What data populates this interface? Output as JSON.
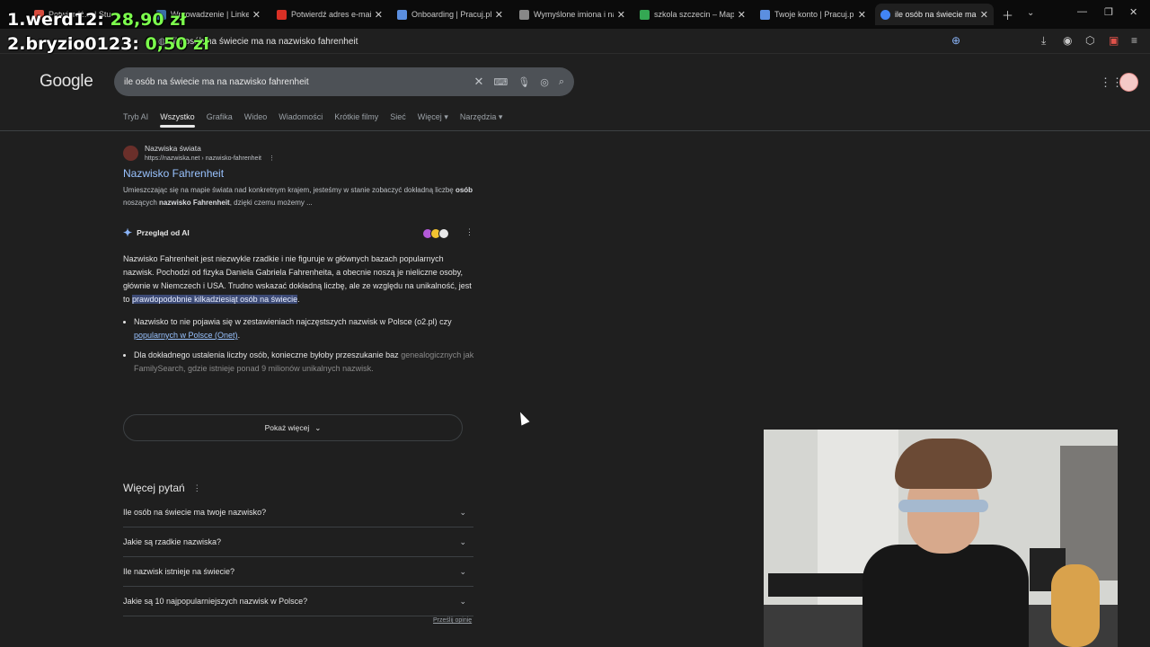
{
  "overlay": {
    "rows": [
      {
        "rank_name": "1.werd12:",
        "amount": "28,90 zł"
      },
      {
        "rank_name": "2.bryzio0123:",
        "amount": "0,50 zł"
      }
    ]
  },
  "tabs": [
    {
      "title": "Potwierdź… | Stu",
      "favicon_color": "#d84c3e"
    },
    {
      "title": "Wprowadzenie | LinkedIn",
      "favicon_color": "#3b6ea5"
    },
    {
      "title": "Potwierdź adres e-mail. Dz",
      "favicon_color": "#d93025"
    },
    {
      "title": "Onboarding | Pracuj.pl",
      "favicon_color": "#5b8fe0"
    },
    {
      "title": "Wymyślone imiona i nazwi",
      "favicon_color": "#888888"
    },
    {
      "title": "szkola szczecin – Mapy Go",
      "favicon_color": "#34a853"
    },
    {
      "title": "Twoje konto | Pracuj.pl",
      "favicon_color": "#5b8fe0"
    },
    {
      "title": "ile osób na świecie ma na n",
      "favicon_color": "#4285f4"
    }
  ],
  "omnibox": {
    "url": "ile osób na świecie ma na nazwisko fahrenheit"
  },
  "google": {
    "logo": "Google",
    "query": "ile osób na świecie ma na nazwisko fahrenheit",
    "filters": [
      "Tryb AI",
      "Wszystko",
      "Grafika",
      "Wideo",
      "Wiadomości",
      "Krótkie filmy",
      "Sieć",
      "Więcej",
      "Narzędzia"
    ]
  },
  "result": {
    "site_name": "Nazwiska świata",
    "site_url": "https://nazwiska.net › nazwisko-fahrenheit",
    "title": "Nazwisko Fahrenheit",
    "snippet_parts": [
      "Umieszczając się na mapie świata nad konkretnym krajem, jesteśmy w stanie zobaczyć dokładną liczbę ",
      "osób",
      " noszących ",
      "nazwisko Fahrenheit",
      ", dzięki czemu możemy ..."
    ]
  },
  "ai_overview": {
    "label": "Przegląd od AI",
    "paragraph_start": "Nazwisko Fahrenheit jest niezwykle rzadkie i nie figuruje w głównych bazach popularnych nazwisk. Pochodzi od fizyka Daniela Gabriela Fahrenheita, a obecnie noszą je nieliczne osoby, głównie w Niemczech i USA. Trudno wskazać dokładną liczbę, ale ze względu na unikalność, jest to ",
    "highlight": "prawdopodobnie kilkadziesiąt osób na świecie",
    "paragraph_end": ".",
    "bullet1_text": "Nazwisko to nie pojawia się w zestawieniach najczęstszych nazwisk w Polsce (o2.pl) czy ",
    "bullet1_link": "popularnych w Polsce (Onet)",
    "bullet1_end": ".",
    "bullet2_text": "Dla dokładnego ustalenia liczby osób, konieczne byłoby przeszukanie baz ",
    "bullet2_fade": "genealogicznych jak FamilySearch, gdzie istnieje ponad 9 milionów unikalnych nazwisk.",
    "show_more": "Pokaż więcej"
  },
  "paa": {
    "title": "Więcej pytań",
    "questions": [
      "Ile osób na świecie ma twoje nazwisko?",
      "Jakie są rzadkie nazwiska?",
      "Ile nazwisk istnieje na świecie?",
      "Jakie są 10 najpopularniejszych nazwisk w Polsce?"
    ],
    "feedback": "Prześlij opinię"
  },
  "colors": {
    "link": "#99c3ff",
    "overlay_amount": "#7cff4d",
    "highlight_bg": "#3c4a75"
  }
}
